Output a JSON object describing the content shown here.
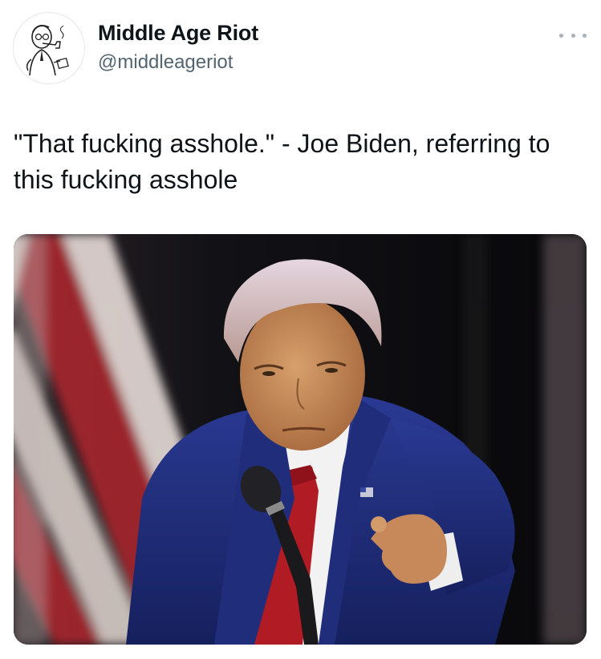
{
  "author": {
    "display_name": "Middle Age Riot",
    "handle": "@middleageriot",
    "avatar_icon": "vintage-man-smoking-pipe-illustration"
  },
  "menu_icon": "more-horizontal-icon",
  "tweet": {
    "text": "\"That fucking asshole.\" - Joe Biden, referring to this fucking asshole"
  },
  "media": {
    "kind": "photo",
    "subject": "man in blue suit with red tie pointing at camera behind microphone, american flag in background"
  },
  "colors": {
    "text": "#0f1419",
    "secondary": "#536471",
    "suit_blue": "#22307a",
    "tie_red": "#b01b24"
  }
}
